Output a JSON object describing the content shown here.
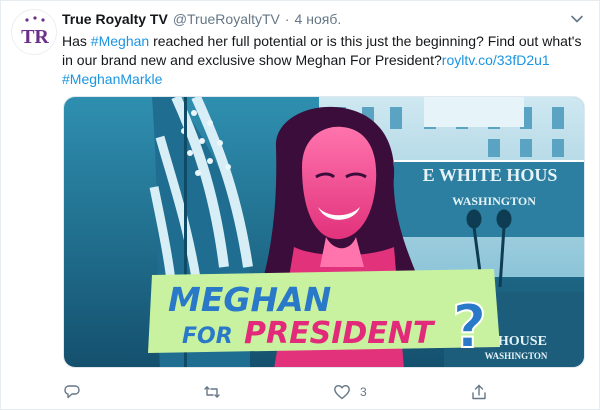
{
  "tweet": {
    "avatar_text": "TR",
    "author_name": "True Royalty TV",
    "handle": "@TrueRoyaltyTV",
    "separator": "·",
    "time": "4 нояб.",
    "text_1": "Has ",
    "hashtag_1": "#Meghan",
    "text_2": " reached her full potential or is this just the beginning? Find out what's in our brand new and exclusive show Meghan For President?",
    "url": "royltv.co/33fD2u1",
    "hashtag_2": "#MeghanMarkle"
  },
  "media": {
    "building_sign_1": "E WHITE HOUS",
    "building_sign_2": "WASHINGTON",
    "podium_sign_1": "E HOUSE",
    "podium_sign_2": "WASHINGTON",
    "headline_1": "MEGHAN",
    "headline_2a": "FOR",
    "headline_2b": "PRESIDENT",
    "headline_mark": "?"
  },
  "actions": {
    "reply_count": "",
    "retweet_count": "",
    "like_count": "3",
    "share_count": ""
  },
  "colors": {
    "link": "#1b95e0",
    "muted": "#657786",
    "avatar_purple": "#6b2f8a",
    "banner_green": "#c9f2a0",
    "banner_blue": "#2a78c8",
    "banner_pink": "#e3297a"
  }
}
